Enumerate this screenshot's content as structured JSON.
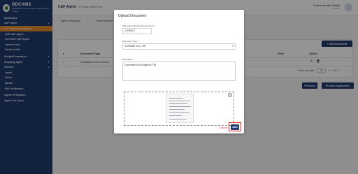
{
  "brand": {
    "name": "BDCAMS",
    "tagline": "Bangladesh Customs Agents Management System"
  },
  "sidebar": {
    "items": [
      {
        "label": "Dashboard",
        "type": "hdr"
      },
      {
        "label": "C&F Agent",
        "type": "hdr",
        "chevron": "up"
      },
      {
        "label": "C&F Agent (In-progress)",
        "type": "active"
      },
      {
        "label": "Add C&F Agent",
        "type": "sub"
      },
      {
        "label": "Licensed C&F Agent",
        "type": "sub"
      },
      {
        "label": "Owner's Info",
        "type": "sub"
      },
      {
        "label": "Sarkar's Info",
        "type": "sub"
      },
      {
        "label": "Freight Forwarders",
        "type": "hdr",
        "chevron": "down"
      },
      {
        "label": "Shipping Agent",
        "type": "hdr",
        "chevron": "down"
      },
      {
        "label": "Reports",
        "type": "hdr",
        "chevron": "up"
      },
      {
        "label": "Agent",
        "type": "sub"
      },
      {
        "label": "Owner",
        "type": "sub"
      },
      {
        "label": "Sarkar",
        "type": "sub"
      },
      {
        "label": "BIN Verification",
        "type": "sub"
      },
      {
        "label": "Agent Verification",
        "type": "hdr"
      },
      {
        "label": "Agent Life Cycle",
        "type": "hdr"
      }
    ]
  },
  "header": {
    "title": "C&F Agent",
    "breadcrumb": "In Progress Agent (Edit)",
    "user_name": "Custom House, Dhaka",
    "user_role": "Institute"
  },
  "tabs": [
    "Agent Information",
    "Owner Informa"
  ],
  "documents": {
    "add_button": "+ Add Document",
    "columns": [
      "#",
      "Document Type",
      "View",
      "Action"
    ],
    "rows": [
      {
        "num": "1",
        "type": "Certificate of INC Incorpor"
      }
    ],
    "pager": {
      "label": "Items per page:",
      "size": "10",
      "range": "1 – 1 of 1"
    }
  },
  "footer_buttons": {
    "previous": "Previous",
    "preview_application": "Preview Application"
  },
  "modal": {
    "title": "Upload Document",
    "fields": {
      "ain": {
        "label": "AIN (Agent Identification Number) *",
        "value": "x-00000-1"
      },
      "doc_type": {
        "label": "Document Type *",
        "value": "Certificate of a / TIN"
      },
      "description": {
        "label": "Description *",
        "value": "Document for Ltd Agent e-TIN"
      }
    },
    "cancel": "Cancel",
    "add": "ADD"
  },
  "colors": {
    "sidebar": "#1f3a6b",
    "accent": "#e28a2b",
    "primary_button": "#1f3a6b",
    "highlight": "#e2231a"
  }
}
